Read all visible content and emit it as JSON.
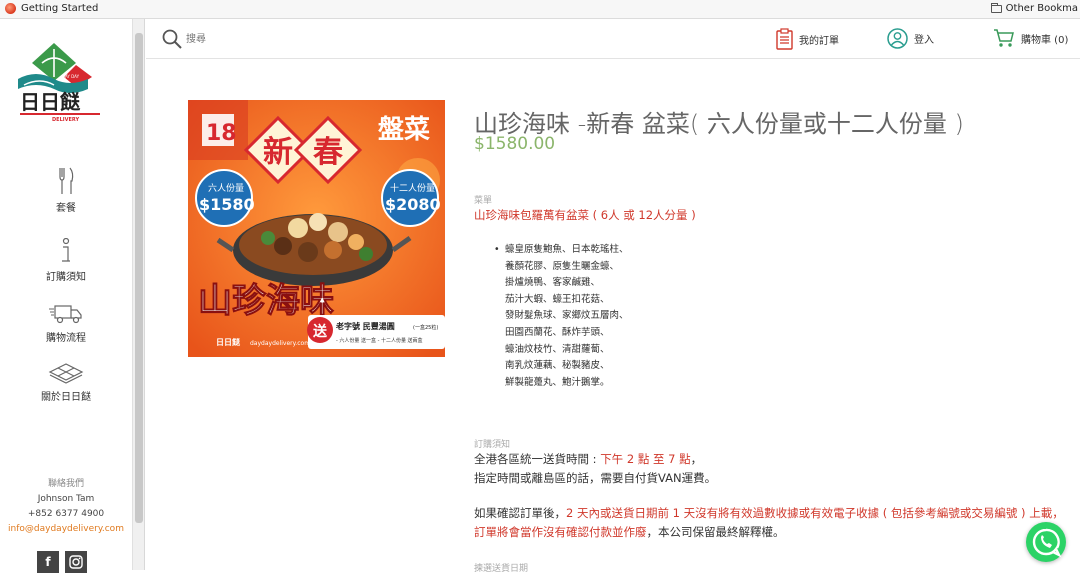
{
  "browser": {
    "bookmark_left": "Getting Started",
    "bookmark_right": "Other Bookma"
  },
  "sidebar": {
    "logo_text": "日日餸",
    "logo_sub": "DELIVERY",
    "logo_badge": "DAY DAY",
    "items": [
      {
        "label": "套餐",
        "icon": "utensils-icon"
      },
      {
        "label": "訂購須知",
        "icon": "info-icon"
      },
      {
        "label": "購物流程",
        "icon": "truck-icon"
      },
      {
        "label": "關於日日餸",
        "icon": "layers-icon"
      }
    ],
    "contact": {
      "heading": "聯絡我們",
      "name": "Johnson Tam",
      "phone": "+852 6377 4900",
      "email": "info@daydaydelivery.com"
    },
    "social": [
      "f",
      "ig"
    ]
  },
  "header": {
    "search_placeholder": "搜尋",
    "orders_label": "我的訂單",
    "login_label": "登入",
    "cart_label": "購物車 (0)"
  },
  "product": {
    "image": {
      "number_badge": "18",
      "title_chars": [
        "新",
        "春"
      ],
      "dish_label": "盤菜",
      "six_label": "六人份量",
      "six_price": "$1580",
      "twelve_label": "十二人份量",
      "twelve_price": "$2080",
      "calligraphy": "山珍海味",
      "gift_tag": "送",
      "gift_text": "老字號 民豐湯圓",
      "gift_qty": "(一盒25粒)",
      "gift_sub": "- 六人份量 送一盒  - 十二人份量 送兩盒",
      "brand": "日日餸",
      "website": "daydaydelivery.com"
    },
    "title": "山珍海味 -新春 盆菜( 六人份量或十二人份量 )",
    "price": "$1580.00",
    "menu_label": "菜單",
    "menu_title": "山珍海味包羅萬有盆菜 ( 6人 或 12人分量 )",
    "dishes": [
      "蠔皇原隻鮑魚、日本乾瑤柱、",
      "養顏花膠、原隻生曬金蠔、",
      "掛爐燒鴨、客家鹹雞、",
      "茄汁大蝦、蠔王扣花菇、",
      "發財髮魚球、家鄉炆五層肉、",
      "田園西蘭花、酥炸芋頭、",
      "蠔油炆枝竹、清甜蘿蔔、",
      "南乳炆蓮藕、秘製豬皮、",
      "鮮製龍躉丸、鮑汁鵝掌。"
    ],
    "notice_label": "訂購須知",
    "notice_line1_a": "全港各區統一送貨時間 : ",
    "notice_line1_b": "下午 2 點 至 7 點",
    "notice_line1_c": "，",
    "notice_line2": "指定時間或離島區的話，需要自付貨VAN運費。",
    "notice_p2_a": "如果確認訂單後，",
    "notice_p2_b": "2 天內或送貨日期前 1 天沒有將有效過數收據或有效電子收據 ( 包括參考編號或交易編號 ) 上載，訂單將會當作沒有確認付款並作廢",
    "notice_p2_c": "，本公司保留最終解釋權。",
    "next_label": "揀選送貨日期"
  },
  "colors": {
    "accent_red": "#d0382b",
    "price_green": "#8bb56b",
    "contact_orange": "#e07a1f",
    "whatsapp_green": "#2bd366"
  }
}
